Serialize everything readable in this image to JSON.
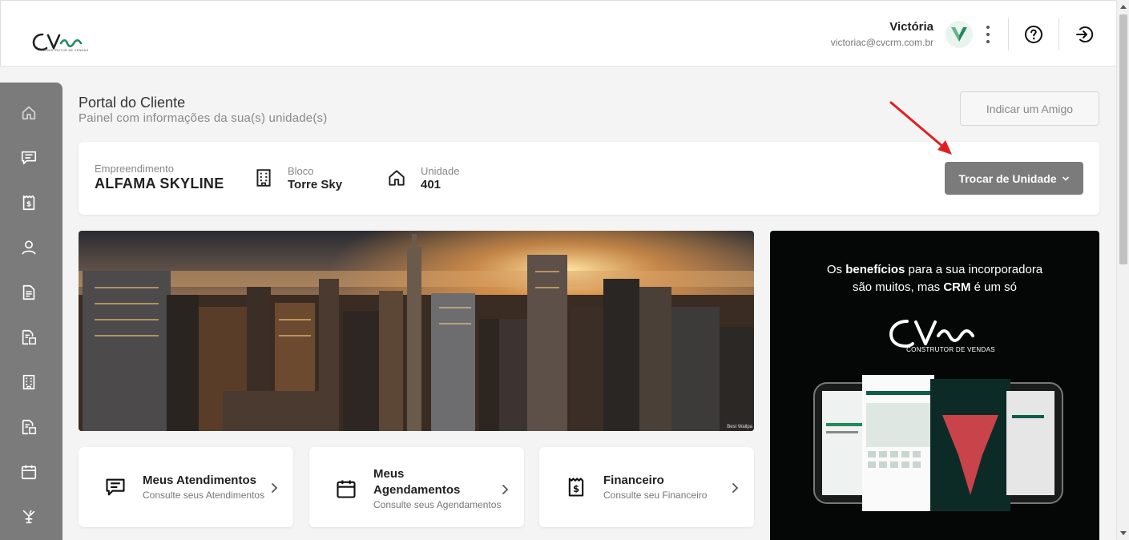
{
  "header": {
    "logo_sub": "CONSTRUTOR DE VENDAS",
    "user_name": "Victória",
    "user_email": "victoriac@cvcrm.com.br",
    "avatar_icon": "avatar-v-icon",
    "menu_icon": "kebab-icon",
    "help_icon": "help-icon",
    "logout_icon": "logout-icon"
  },
  "sidebar": {
    "items": [
      {
        "icon": "home-icon"
      },
      {
        "icon": "chat-icon"
      },
      {
        "icon": "finance-icon"
      },
      {
        "icon": "user-icon"
      },
      {
        "icon": "document-icon"
      },
      {
        "icon": "document-search-icon"
      },
      {
        "icon": "building-icon"
      },
      {
        "icon": "document-search-icon"
      },
      {
        "icon": "calendar-icon"
      },
      {
        "icon": "tools-icon"
      }
    ]
  },
  "page": {
    "title": "Portal do Cliente",
    "subtitle": "Painel com informações da sua(s) unidade(s)",
    "indicar_label": "Indicar um Amigo"
  },
  "unit": {
    "empreendimento_label": "Empreendimento",
    "empreendimento_value": "ALFAMA SKYLINE",
    "bloco_label": "Bloco",
    "bloco_value": "Torre Sky",
    "unidade_label": "Unidade",
    "unidade_value": "401",
    "trocar_label": "Trocar de Unidade"
  },
  "banner": {
    "credit": "Best Wallpa"
  },
  "promo": {
    "line1_pre": "Os ",
    "line1_bold": "benefícios",
    "line1_post": " para a sua incorporadora",
    "line2_pre": "são muitos, mas ",
    "line2_bold": "CRM",
    "line2_post": " é um só",
    "logo_sub": "CONSTRUTOR DE VENDAS"
  },
  "cards": [
    {
      "title": "Meus Atendimentos",
      "subtitle": "Consulte seus Atendimentos",
      "icon": "chat-icon"
    },
    {
      "title": "Meus Agendamentos",
      "subtitle": "Consulte seus Agendamentos",
      "icon": "calendar-icon"
    },
    {
      "title": "Financeiro",
      "subtitle": "Consulte seu Financeiro",
      "icon": "finance-icon"
    }
  ],
  "colors": {
    "brand_green": "#1f8a5b",
    "sidebar_gray": "#7b7b7b",
    "arrow_red": "#e02020"
  }
}
